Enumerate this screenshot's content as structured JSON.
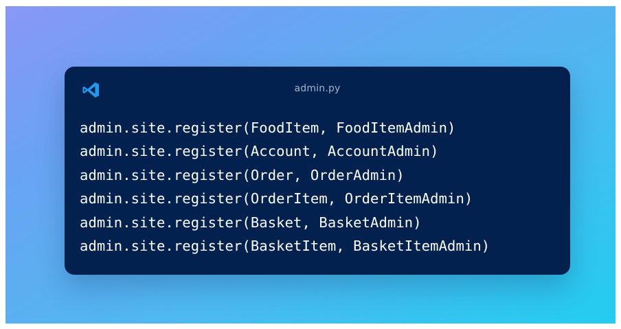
{
  "window": {
    "file_name": "admin.py",
    "icon": "vscode-icon"
  },
  "code": {
    "lines": [
      "admin.site.register(FoodItem, FoodItemAdmin)",
      "admin.site.register(Account, AccountAdmin)",
      "admin.site.register(Order, OrderAdmin)",
      "admin.site.register(OrderItem, OrderItemAdmin)",
      "admin.site.register(Basket, BasketAdmin)",
      "admin.site.register(BasketItem, BasketItemAdmin)"
    ]
  },
  "colors": {
    "card_background": "#03214f",
    "icon_accent": "#1f9cf0",
    "code_text": "#ffffff",
    "filename_text": "#a3b3c9"
  }
}
